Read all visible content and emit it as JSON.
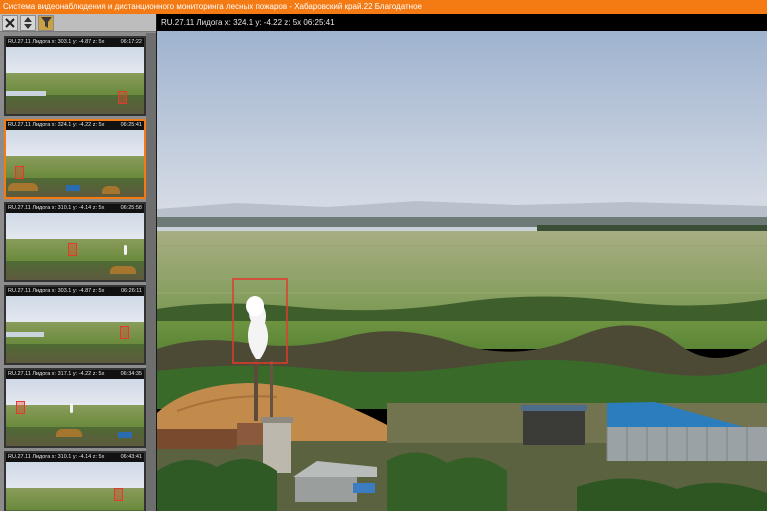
{
  "window": {
    "title": "Система видеонаблюдения и дистанционного мониторинга лесных пожаров - Хабаровский край.22 Благодатное"
  },
  "toolbar": {
    "close_icon": "close-icon",
    "sort_icon": "sort-arrows-icon",
    "filter_icon": "filter-funnel-icon"
  },
  "sidebar": {
    "thumbnails": [
      {
        "caption": "RU.27.11 Лидога x: 303.1 y: -4.87 z: 5x",
        "time": "06:17:22",
        "active": false
      },
      {
        "caption": "RU.27.11 Лидога x: 324.1 y: -4.22 z: 5x",
        "time": "06:25:41",
        "active": true
      },
      {
        "caption": "RU.27.11 Лидога x: 310.1 y: -4.14 z: 5x",
        "time": "06:25:58",
        "active": false
      },
      {
        "caption": "RU.27.11 Лидога x: 303.1 y: -4.87 z: 5x",
        "time": "06:26:11",
        "active": false
      },
      {
        "caption": "RU.27.11 Лидога x: 317.1 y: -4.22 z: 5x",
        "time": "06:34:35",
        "active": false
      },
      {
        "caption": "RU.27.11 Лидога x: 310.1 y: -4.14 z: 5x",
        "time": "06:43:41",
        "active": false
      }
    ]
  },
  "main": {
    "camera_caption": "RU.27.11 Лидога x: 324.1 y: -4.22 z: 5x 06:25:41"
  },
  "colors": {
    "accent": "#f47a14",
    "detection_box": "#e23b2b"
  }
}
